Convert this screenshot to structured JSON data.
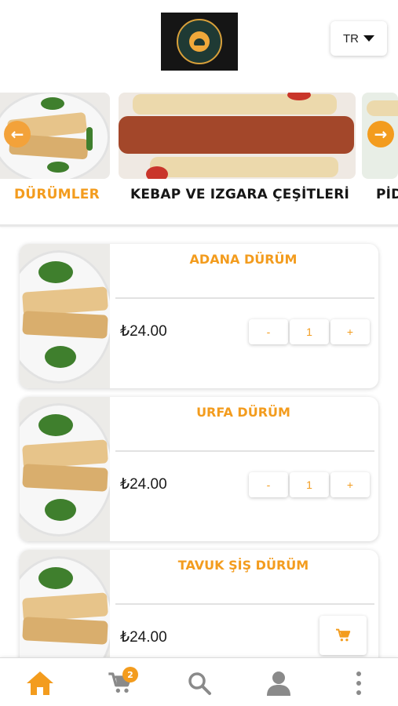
{
  "header": {
    "logo_alt": "ÖKKEŞ DEMİR",
    "language": "TR"
  },
  "categories": {
    "items": [
      {
        "label": "DÜRÜMLER",
        "active": true
      },
      {
        "label": "KEBAP VE IZGARA ÇEŞİTLERİ",
        "active": false
      },
      {
        "label": "PİD",
        "active": false
      }
    ],
    "prev_icon": "arrow-left-icon",
    "next_icon": "arrow-right-icon"
  },
  "products": [
    {
      "name": "ADANA DÜRÜM",
      "price": "₺24.00",
      "quantity": "1",
      "minus": "-",
      "plus": "+"
    },
    {
      "name": "URFA DÜRÜM",
      "price": "₺24.00",
      "quantity": "1",
      "minus": "-",
      "plus": "+"
    },
    {
      "name": "TAVUK ŞİŞ DÜRÜM",
      "price": "₺24.00"
    }
  ],
  "bottom_nav": {
    "items": [
      "home-icon",
      "cart-icon",
      "search-icon",
      "user-icon",
      "more-icon"
    ],
    "cart_count": "2"
  },
  "colors": {
    "accent": "#f39c1e",
    "icon_gray": "#8a8a8a"
  }
}
